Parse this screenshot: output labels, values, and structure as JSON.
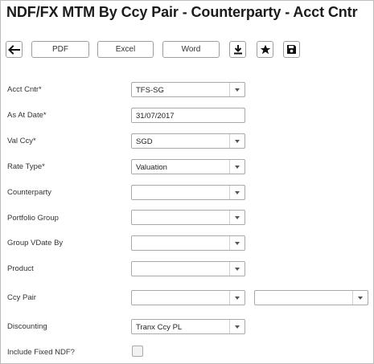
{
  "page": {
    "title": "NDF/FX MTM By Ccy Pair - Counterparty - Acct Cntr"
  },
  "toolbar": {
    "back_icon": "arrow-left-icon",
    "pdf_label": "PDF",
    "excel_label": "Excel",
    "word_label": "Word",
    "download_icon": "download-icon",
    "favorite_icon": "star-icon",
    "save_icon": "floppy-disk-icon"
  },
  "form": {
    "acct_cntr": {
      "label": "Acct Cntr*",
      "value": "TFS-SG"
    },
    "as_at_date": {
      "label": "As At Date*",
      "value": "31/07/2017"
    },
    "val_ccy": {
      "label": "Val Ccy*",
      "value": "SGD"
    },
    "rate_type": {
      "label": "Rate Type*",
      "value": "Valuation"
    },
    "counterparty": {
      "label": "Counterparty",
      "value": ""
    },
    "portfolio_group": {
      "label": "Portfolio Group",
      "value": ""
    },
    "group_vdate_by": {
      "label": "Group VDate By",
      "value": ""
    },
    "product": {
      "label": "Product",
      "value": ""
    },
    "ccy_pair": {
      "label": "Ccy Pair",
      "value_1": "",
      "value_2": ""
    },
    "discounting": {
      "label": "Discounting",
      "value": "Tranx Ccy PL"
    },
    "include_fixed_ndf": {
      "label": "Include Fixed NDF?",
      "checked": false
    }
  },
  "colors": {
    "border": "#a9a9a9",
    "text": "#222222",
    "dropdown_arrow": "#555555"
  }
}
